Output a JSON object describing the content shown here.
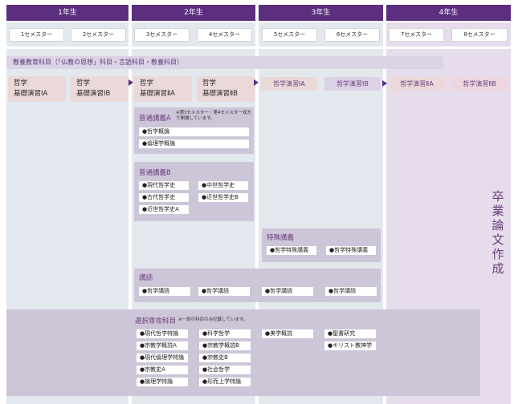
{
  "years": [
    "1年生",
    "2年生",
    "3年生",
    "4年生"
  ],
  "semesters": [
    "1セメスター",
    "2セメスター",
    "3セメスター",
    "4セメスター",
    "5セメスター",
    "6セメスター",
    "7セメスター",
    "8セメスター"
  ],
  "general_education": "教養教育科目（「仏教の思想」科目・言語科目・教養科目）",
  "basic_seminars": [
    {
      "line1": "哲学",
      "line2": "基礎演習ⅠA"
    },
    {
      "line1": "哲学",
      "line2": "基礎演習ⅠB"
    },
    {
      "line1": "哲学",
      "line2": "基礎演習ⅡA"
    },
    {
      "line1": "哲学",
      "line2": "基礎演習ⅡB"
    }
  ],
  "seminars": [
    "哲学演習ⅠA",
    "哲学演習ⅠB",
    "哲学演習ⅡA",
    "哲学演習ⅡB"
  ],
  "lecture_a": {
    "title": "普通講義A",
    "note": "※第3セメスター・第4セメスター双方で開講しています。",
    "items": [
      "●哲学概論",
      "●倫理学概論"
    ]
  },
  "lecture_b": {
    "title": "普通講義B",
    "items_left": [
      "●現代哲学史",
      "●古代哲学史",
      "●近世哲学史A"
    ],
    "items_right": [
      "●中世哲学史",
      "●近世哲学史B"
    ]
  },
  "special_lecture": {
    "title": "特殊講義",
    "items": [
      "●哲学特殊講義",
      "●哲学特殊講義"
    ]
  },
  "reading": {
    "title": "講読",
    "items": [
      "●哲学講読",
      "●哲学講読",
      "●哲学講読",
      "●哲学講読"
    ]
  },
  "electives": {
    "title": "選択専攻科目",
    "note": "※一部の科目のみ記載しています。",
    "col1": [
      "●現代哲学特論",
      "●宗教学概説A",
      "●現代倫理学特論",
      "●宗教史A",
      "●論理学特論"
    ],
    "col2": [
      "●科学哲学",
      "●宗教学概説B",
      "●宗教史B",
      "●社会哲学",
      "●形而上学特論"
    ],
    "col3": [
      "●美学概説"
    ],
    "col4": [
      "●聖書研究",
      "●キリスト教神学"
    ]
  },
  "thesis": "卒業論文作成",
  "colors": {
    "year_header": "#5b2e7f",
    "panel": "#cdc5d8",
    "seminar_pink": "#ead9d8"
  }
}
